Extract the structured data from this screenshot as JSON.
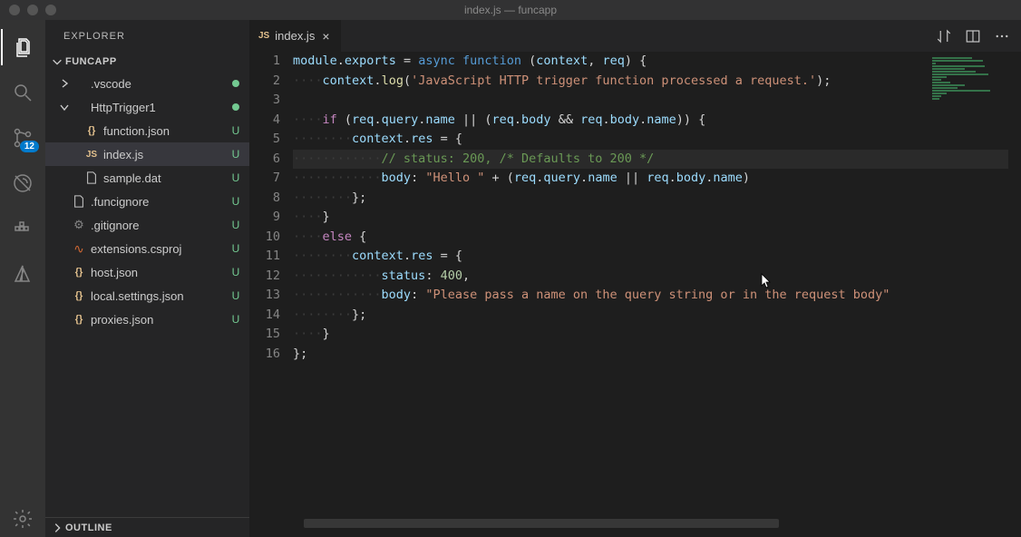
{
  "window": {
    "title": "index.js — funcapp"
  },
  "explorer": {
    "title": "EXPLORER",
    "project": "FUNCAPP",
    "outline": "OUTLINE"
  },
  "scm_badge": "12",
  "tree": [
    {
      "depth": 0,
      "twisty": "right",
      "icon": "none",
      "label": ".vscode",
      "status": "dot"
    },
    {
      "depth": 0,
      "twisty": "down",
      "icon": "none",
      "label": "HttpTrigger1",
      "status": "dot"
    },
    {
      "depth": 1,
      "twisty": "",
      "icon": "json",
      "label": "function.json",
      "status": "U"
    },
    {
      "depth": 1,
      "twisty": "",
      "icon": "js",
      "label": "index.js",
      "status": "U",
      "selected": true
    },
    {
      "depth": 1,
      "twisty": "",
      "icon": "file",
      "label": "sample.dat",
      "status": "U"
    },
    {
      "depth": 0,
      "twisty": "",
      "icon": "file",
      "label": ".funcignore",
      "status": "U"
    },
    {
      "depth": 0,
      "twisty": "",
      "icon": "gear",
      "label": ".gitignore",
      "status": "U"
    },
    {
      "depth": 0,
      "twisty": "",
      "icon": "rss",
      "label": "extensions.csproj",
      "status": "U"
    },
    {
      "depth": 0,
      "twisty": "",
      "icon": "json",
      "label": "host.json",
      "status": "U"
    },
    {
      "depth": 0,
      "twisty": "",
      "icon": "json",
      "label": "local.settings.json",
      "status": "U"
    },
    {
      "depth": 0,
      "twisty": "",
      "icon": "json",
      "label": "proxies.json",
      "status": "U"
    }
  ],
  "tab": {
    "label": "index.js"
  },
  "code": {
    "lines": [
      [
        [
          "id",
          "module"
        ],
        [
          "pn",
          "."
        ],
        [
          "id",
          "exports"
        ],
        [
          "pn",
          " = "
        ],
        [
          "kw2",
          "async"
        ],
        [
          "pn",
          " "
        ],
        [
          "kw2",
          "function"
        ],
        [
          "pn",
          " ("
        ],
        [
          "id",
          "context"
        ],
        [
          "pn",
          ", "
        ],
        [
          "id",
          "req"
        ],
        [
          "pn",
          ") {"
        ]
      ],
      [
        [
          "ws",
          "····"
        ],
        [
          "id",
          "context"
        ],
        [
          "pn",
          "."
        ],
        [
          "fn",
          "log"
        ],
        [
          "pn",
          "("
        ],
        [
          "str",
          "'JavaScript HTTP trigger function processed a request.'"
        ],
        [
          "pn",
          ");"
        ]
      ],
      [],
      [
        [
          "ws",
          "····"
        ],
        [
          "kw",
          "if"
        ],
        [
          "pn",
          " ("
        ],
        [
          "id",
          "req"
        ],
        [
          "pn",
          "."
        ],
        [
          "id",
          "query"
        ],
        [
          "pn",
          "."
        ],
        [
          "id",
          "name"
        ],
        [
          "pn",
          " || ("
        ],
        [
          "id",
          "req"
        ],
        [
          "pn",
          "."
        ],
        [
          "id",
          "body"
        ],
        [
          "pn",
          " && "
        ],
        [
          "id",
          "req"
        ],
        [
          "pn",
          "."
        ],
        [
          "id",
          "body"
        ],
        [
          "pn",
          "."
        ],
        [
          "id",
          "name"
        ],
        [
          "pn",
          ")) {"
        ]
      ],
      [
        [
          "ws",
          "········"
        ],
        [
          "id",
          "context"
        ],
        [
          "pn",
          "."
        ],
        [
          "id",
          "res"
        ],
        [
          "pn",
          " = {"
        ]
      ],
      [
        [
          "ws",
          "············"
        ],
        [
          "cm",
          "// status: 200, /* Defaults to 200 */"
        ]
      ],
      [
        [
          "ws",
          "············"
        ],
        [
          "id",
          "body"
        ],
        [
          "pn",
          ": "
        ],
        [
          "str",
          "\"Hello \""
        ],
        [
          "pn",
          " + ("
        ],
        [
          "id",
          "req"
        ],
        [
          "pn",
          "."
        ],
        [
          "id",
          "query"
        ],
        [
          "pn",
          "."
        ],
        [
          "id",
          "name"
        ],
        [
          "pn",
          " || "
        ],
        [
          "id",
          "req"
        ],
        [
          "pn",
          "."
        ],
        [
          "id",
          "body"
        ],
        [
          "pn",
          "."
        ],
        [
          "id",
          "name"
        ],
        [
          "pn",
          ")"
        ]
      ],
      [
        [
          "ws",
          "········"
        ],
        [
          "pn",
          "};"
        ]
      ],
      [
        [
          "ws",
          "····"
        ],
        [
          "pn",
          "}"
        ]
      ],
      [
        [
          "ws",
          "····"
        ],
        [
          "kw",
          "else"
        ],
        [
          "pn",
          " {"
        ]
      ],
      [
        [
          "ws",
          "········"
        ],
        [
          "id",
          "context"
        ],
        [
          "pn",
          "."
        ],
        [
          "id",
          "res"
        ],
        [
          "pn",
          " = {"
        ]
      ],
      [
        [
          "ws",
          "············"
        ],
        [
          "id",
          "status"
        ],
        [
          "pn",
          ": "
        ],
        [
          "num",
          "400"
        ],
        [
          "pn",
          ","
        ]
      ],
      [
        [
          "ws",
          "············"
        ],
        [
          "id",
          "body"
        ],
        [
          "pn",
          ": "
        ],
        [
          "str",
          "\"Please pass a name on the query string or in the request body\""
        ]
      ],
      [
        [
          "ws",
          "········"
        ],
        [
          "pn",
          "};"
        ]
      ],
      [
        [
          "ws",
          "····"
        ],
        [
          "pn",
          "}"
        ]
      ],
      [
        [
          "pn",
          "};"
        ]
      ]
    ],
    "highlight_line": 6
  }
}
